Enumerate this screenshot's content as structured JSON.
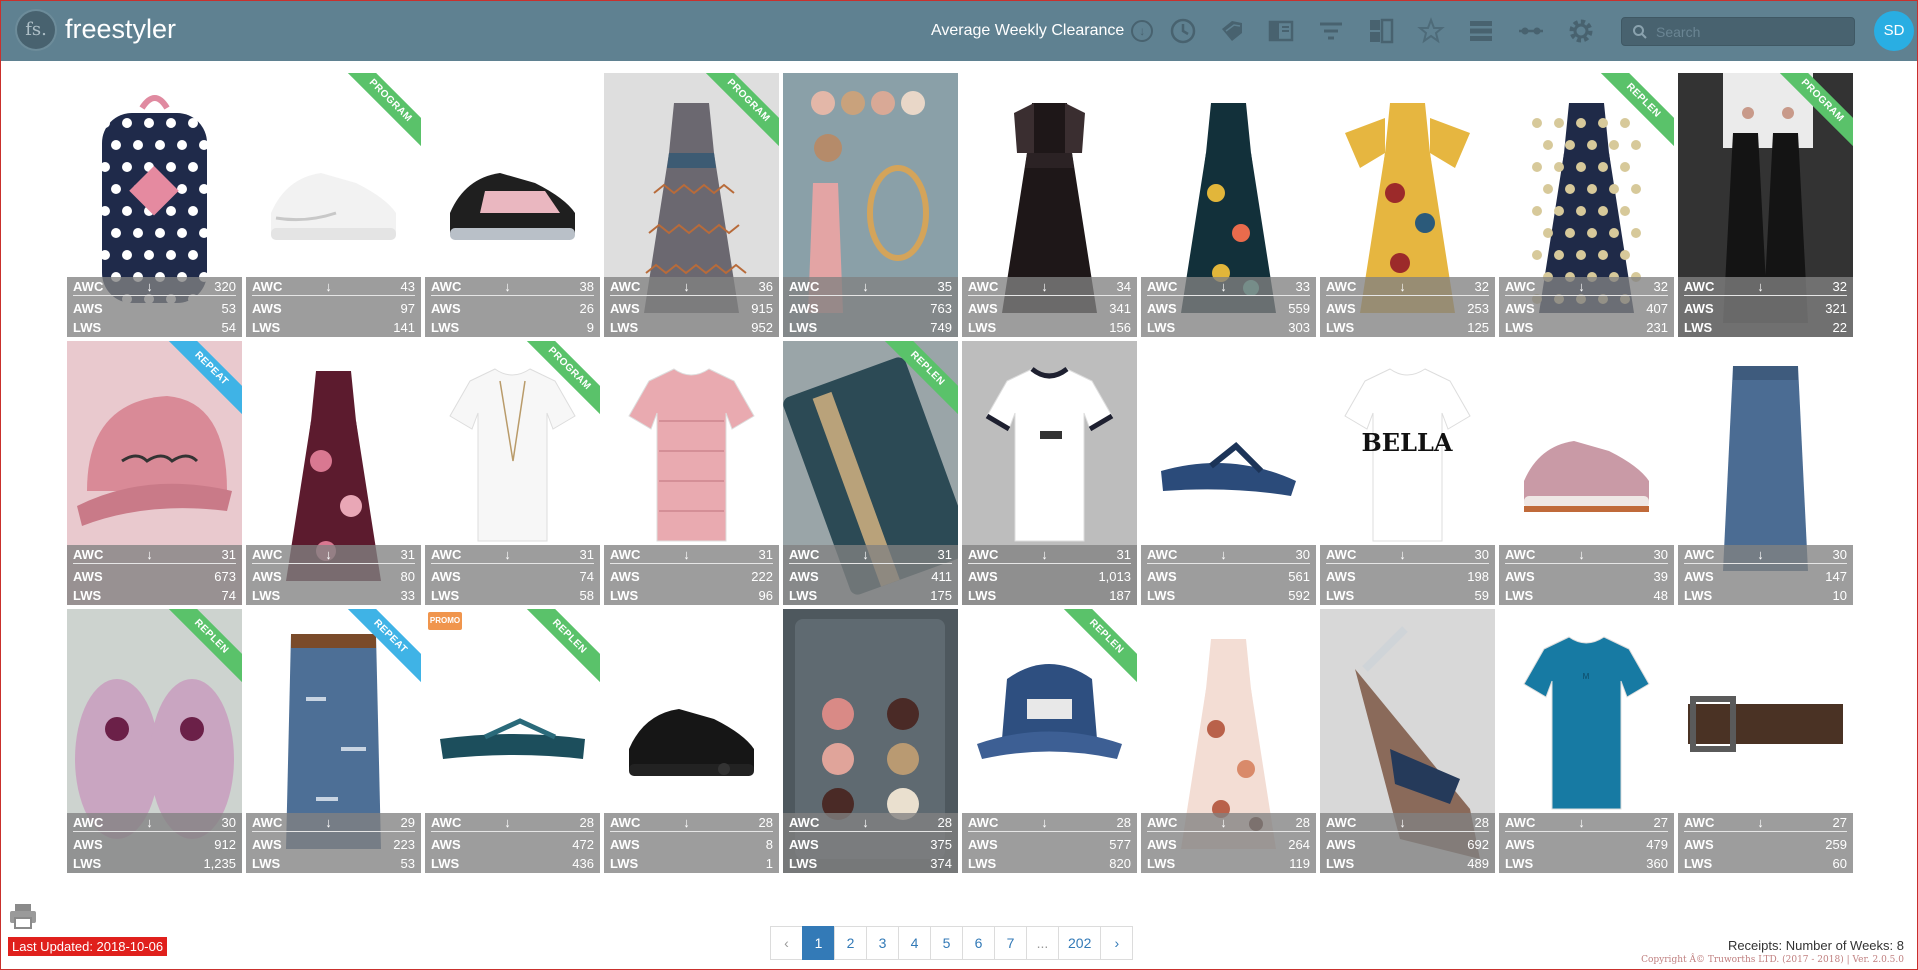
{
  "app": {
    "logo_text": "fs.",
    "brand": "freestyler",
    "metric_label": "Average Weekly Clearance",
    "user_initials": "SD"
  },
  "colors": {
    "header": "#5f8191",
    "program": "#5ac26a",
    "replen": "#5ac26a",
    "repeat": "#3fb3e6",
    "promo": "#f0954d",
    "active_page": "#337ab7"
  },
  "header_icons": [
    "clock-icon",
    "tags-icon",
    "book-icon",
    "filter-icon",
    "layout-icon",
    "star-icon",
    "list-icon",
    "slider-icon",
    "gear-icon"
  ],
  "search": {
    "placeholder": "Search"
  },
  "stat_labels": {
    "awc": "AWC",
    "aws": "AWS",
    "lws": "LWS",
    "trend_icon": "↓"
  },
  "products": [
    {
      "item": "polka-dot-backpack",
      "awc": "320",
      "aws": "53",
      "lws": "54",
      "tag": ""
    },
    {
      "item": "white-sneaker",
      "awc": "43",
      "aws": "97",
      "lws": "141",
      "tag": "PROGRAM"
    },
    {
      "item": "pink-black-sneaker",
      "awc": "38",
      "aws": "26",
      "lws": "9",
      "tag": ""
    },
    {
      "item": "chevron-maxi-dress",
      "awc": "36",
      "aws": "915",
      "lws": "952",
      "tag": "PROGRAM"
    },
    {
      "item": "earring-set",
      "awc": "35",
      "aws": "763",
      "lws": "749",
      "tag": ""
    },
    {
      "item": "black-lace-dress",
      "awc": "34",
      "aws": "341",
      "lws": "156",
      "tag": ""
    },
    {
      "item": "floral-maxi-dress",
      "awc": "33",
      "aws": "559",
      "lws": "303",
      "tag": ""
    },
    {
      "item": "yellow-floral-dress",
      "awc": "32",
      "aws": "253",
      "lws": "125",
      "tag": ""
    },
    {
      "item": "navy-polka-dress",
      "awc": "32",
      "aws": "407",
      "lws": "231",
      "tag": "REPLEN"
    },
    {
      "item": "tassel-earrings",
      "awc": "32",
      "aws": "321",
      "lws": "22",
      "tag": "PROGRAM"
    },
    {
      "item": "pink-cap",
      "awc": "31",
      "aws": "673",
      "lws": "74",
      "tag": "REPEAT"
    },
    {
      "item": "burgundy-floral-dress",
      "awc": "31",
      "aws": "80",
      "lws": "33",
      "tag": ""
    },
    {
      "item": "white-top-necklace",
      "awc": "31",
      "aws": "74",
      "lws": "58",
      "tag": "PROGRAM"
    },
    {
      "item": "pink-knit-jersey",
      "awc": "31",
      "aws": "222",
      "lws": "96",
      "tag": ""
    },
    {
      "item": "teal-wallet",
      "awc": "31",
      "aws": "411",
      "lws": "175",
      "tag": "REPLEN"
    },
    {
      "item": "ringer-tee",
      "awc": "31",
      "aws": "1,013",
      "lws": "187",
      "tag": ""
    },
    {
      "item": "navy-flip-flop",
      "awc": "30",
      "aws": "561",
      "lws": "592",
      "tag": ""
    },
    {
      "item": "ciao-bella-tee",
      "awc": "30",
      "aws": "198",
      "lws": "59",
      "tag": ""
    },
    {
      "item": "pink-chunky-sneaker",
      "awc": "30",
      "aws": "39",
      "lws": "48",
      "tag": ""
    },
    {
      "item": "denim-pencil-skirt",
      "awc": "30",
      "aws": "147",
      "lws": "10",
      "tag": ""
    },
    {
      "item": "fluffy-slippers",
      "awc": "30",
      "aws": "912",
      "lws": "1,235",
      "tag": "REPLEN"
    },
    {
      "item": "distressed-denim-skirt",
      "awc": "29",
      "aws": "223",
      "lws": "53",
      "tag": "REPEAT"
    },
    {
      "item": "teal-flip-flop",
      "awc": "28",
      "aws": "472",
      "lws": "436",
      "tag": "REPLEN",
      "promo": "PROMO"
    },
    {
      "item": "black-air-sneaker",
      "awc": "28",
      "aws": "8",
      "lws": "1",
      "tag": ""
    },
    {
      "item": "stud-earring-card",
      "awc": "28",
      "aws": "375",
      "lws": "374",
      "tag": ""
    },
    {
      "item": "denim-bucket-hat",
      "awc": "28",
      "aws": "577",
      "lws": "820",
      "tag": "REPLEN"
    },
    {
      "item": "peach-floral-dress",
      "awc": "28",
      "aws": "264",
      "lws": "119",
      "tag": ""
    },
    {
      "item": "strappy-sandal",
      "awc": "28",
      "aws": "692",
      "lws": "489",
      "tag": ""
    },
    {
      "item": "blue-tee",
      "awc": "27",
      "aws": "479",
      "lws": "360",
      "tag": ""
    },
    {
      "item": "brown-belt",
      "awc": "27",
      "aws": "259",
      "lws": "60",
      "tag": ""
    }
  ],
  "footer": {
    "last_updated": "Last Updated: 2018-10-06",
    "receipts": "Receipts: Number of Weeks: 8",
    "copyright": "Copyright Â© Truworths LTD. (2017 - 2018) | Ver. 2.0.5.0"
  },
  "pagination": {
    "prev": "‹",
    "pages": [
      "1",
      "2",
      "3",
      "4",
      "5",
      "6",
      "7",
      "...",
      "202"
    ],
    "next": "›",
    "current": "1"
  }
}
